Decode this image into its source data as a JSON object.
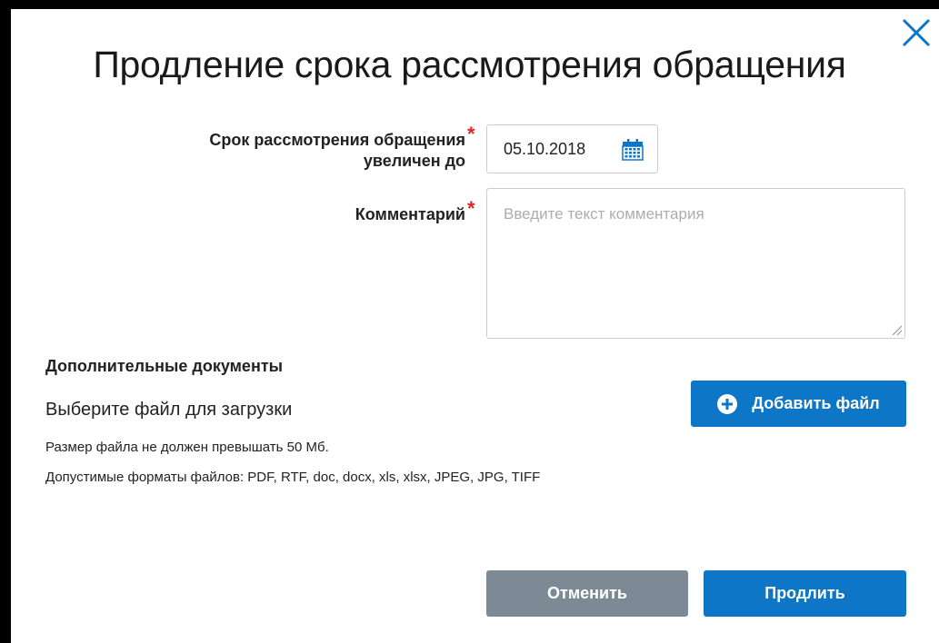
{
  "dialog": {
    "title": "Продление срока рассмотрения обращения",
    "close_icon": "close-icon"
  },
  "form": {
    "deadline": {
      "label_line1": "Срок рассмотрения обращения",
      "label_line2": "увеличен до",
      "required_mark": "*",
      "value": "05.10.2018",
      "icon": "calendar-icon"
    },
    "comment": {
      "label": "Комментарий",
      "required_mark": "*",
      "value": "",
      "placeholder": "Введите текст комментария"
    }
  },
  "attachments": {
    "section_title": "Дополнительные документы",
    "choose_label": "Выберите файл для загрузки",
    "add_button_label": "Добавить файл",
    "add_button_icon": "plus-circle-icon",
    "size_hint": "Размер файла не должен превышать 50 Мб.",
    "formats_hint": "Допустимые форматы файлов: PDF, RTF, doc, docx, xls, xlsx, JPEG, JPG, TIFF"
  },
  "actions": {
    "cancel_label": "Отменить",
    "extend_label": "Продлить"
  },
  "colors": {
    "primary": "#0d76c6",
    "secondary": "#7d8a96",
    "required": "#d9262b"
  }
}
